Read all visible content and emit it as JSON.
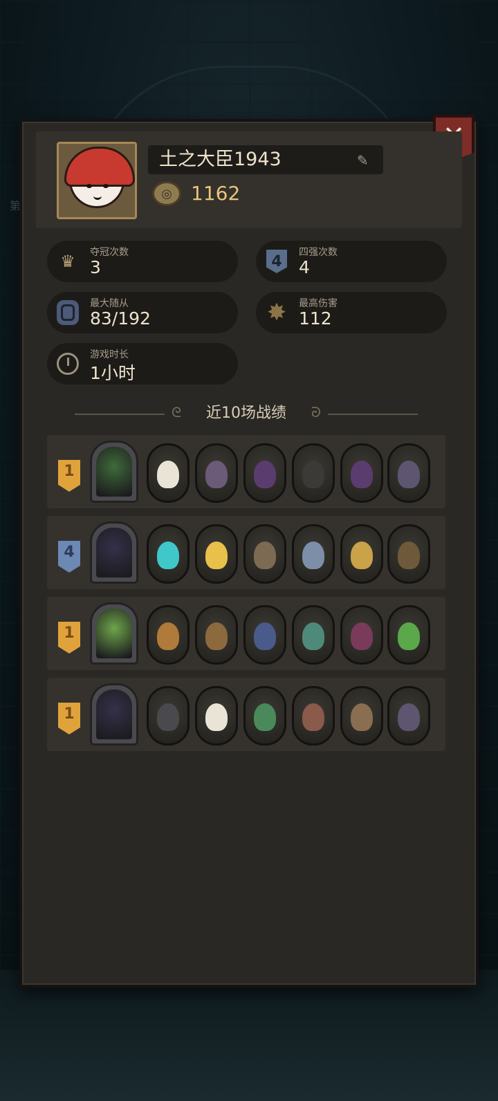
{
  "background": {
    "side_text": "第"
  },
  "profile": {
    "name": "土之大臣1943",
    "rating": "1162",
    "avatar": "red-hood-girl-avatar"
  },
  "stats": [
    {
      "label": "夺冠次数",
      "value": "3",
      "icon": "crown-icon"
    },
    {
      "label": "四强次数",
      "value": "4",
      "icon": "shield-four-icon"
    },
    {
      "label": "最大随从",
      "value": "83/192",
      "icon": "minion-badge-icon"
    },
    {
      "label": "最高伤害",
      "value": "112",
      "icon": "damage-star-icon"
    },
    {
      "label": "游戏时长",
      "value": "1小时",
      "icon": "clock-icon"
    }
  ],
  "history": {
    "title": "近10场战绩",
    "matches": [
      {
        "rank": "1",
        "rank_color": "#e0a33c",
        "hero_color": "#3e6b3a",
        "minions": [
          "#e9e4d6",
          "#6b5a78",
          "#5a3d6e",
          "#3c3a36",
          "#5a3d6e",
          "#5e5670"
        ]
      },
      {
        "rank": "4",
        "rank_color": "#6c88b4",
        "hero_color": "#35304a",
        "minions": [
          "#3fc7c9",
          "#e8c04a",
          "#7c6a52",
          "#7d8fa8",
          "#c9a24a",
          "#6e5a3a"
        ]
      },
      {
        "rank": "1",
        "rank_color": "#e0a33c",
        "hero_color": "#6ea54a",
        "minions": [
          "#b07a3a",
          "#8c6a3e",
          "#4a5a8a",
          "#4e8a7a",
          "#7a3a5a",
          "#5aa84a"
        ]
      },
      {
        "rank": "1",
        "rank_color": "#e0a33c",
        "hero_color": "#35304a",
        "minions": [
          "#4a4a4e",
          "#e9e4d6",
          "#4a8a5a",
          "#8a5a4a",
          "#8a6e52",
          "#5e5670"
        ]
      }
    ]
  }
}
